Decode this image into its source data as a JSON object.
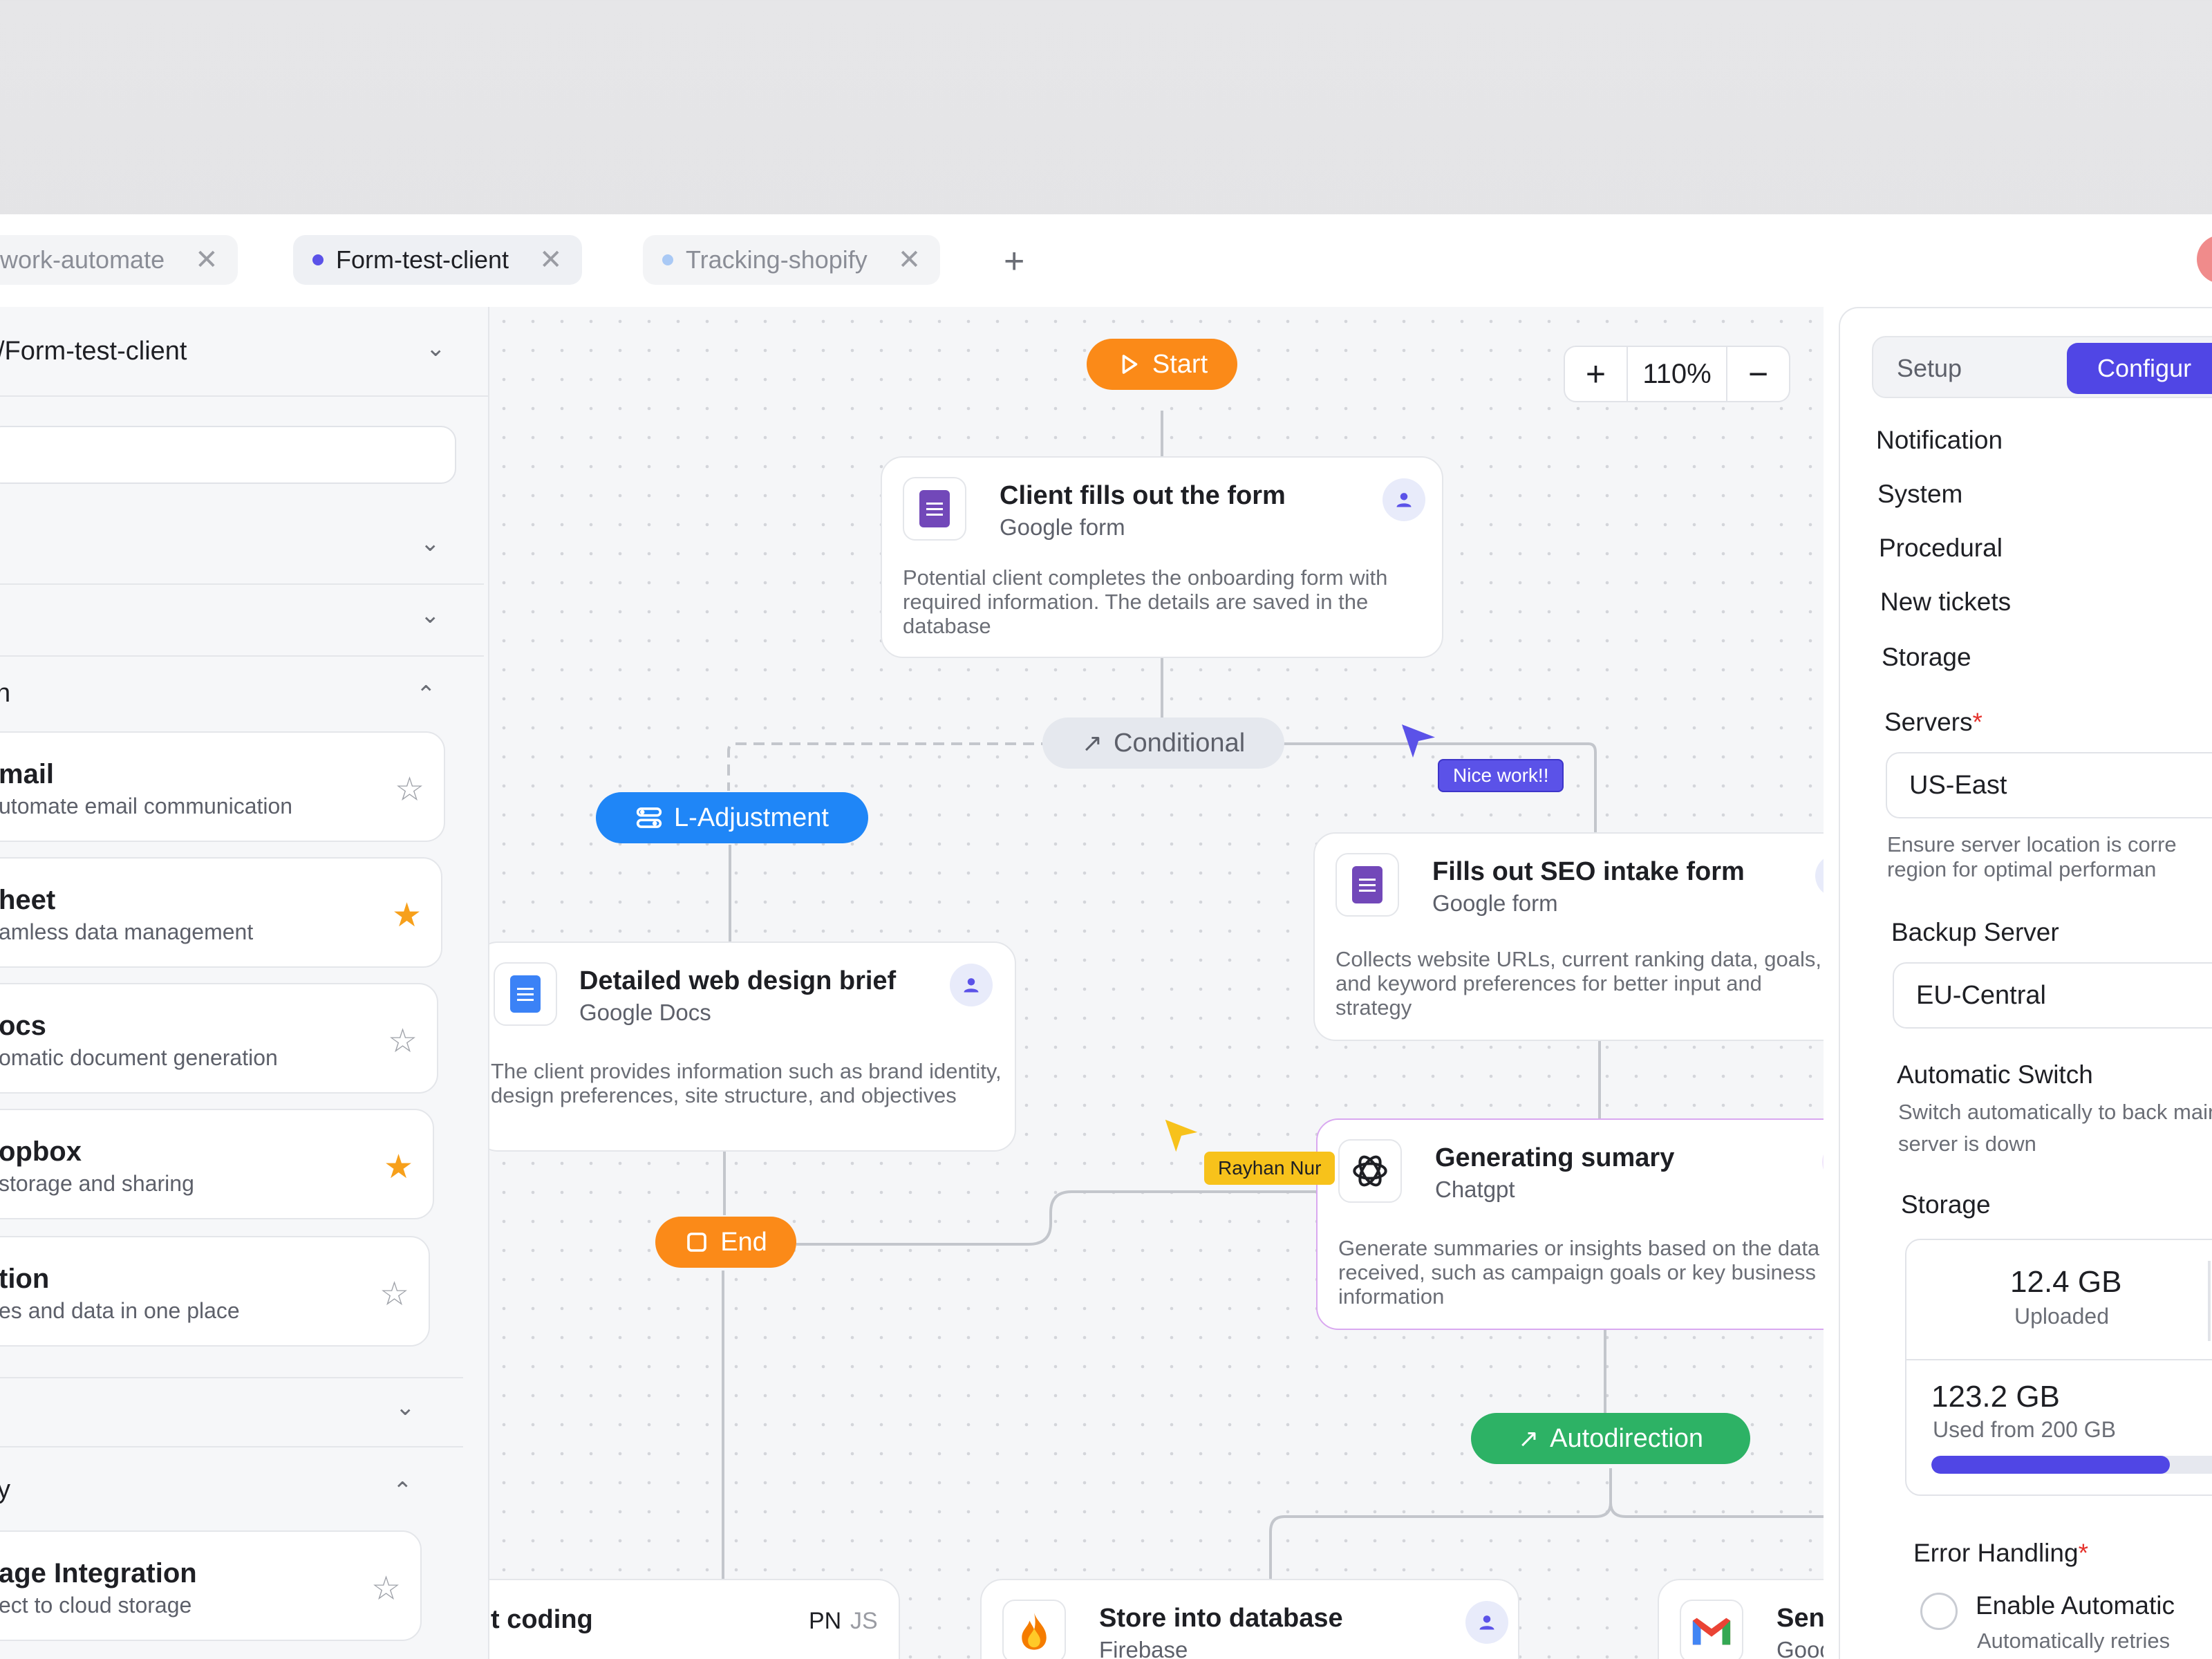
{
  "tabs": [
    {
      "label": "work-automate",
      "active": false,
      "dot_color": ""
    },
    {
      "label": "Form-test-client",
      "active": true,
      "dot_color": "#5b52e8"
    },
    {
      "label": "Tracking-shopify",
      "active": false,
      "dot_color": "#a9c9f5"
    }
  ],
  "sidebar": {
    "header": "/Form-test-client",
    "search_value": "",
    "sections": [
      {
        "label": ""
      },
      {
        "label": ""
      },
      {
        "label": "n"
      }
    ],
    "integrations": [
      {
        "title": "mail",
        "subtitle": "utomate email communication",
        "starred": false
      },
      {
        "title": "heet",
        "subtitle": "amless data management",
        "starred": true
      },
      {
        "title": "ocs",
        "subtitle": "omatic document generation",
        "starred": false
      },
      {
        "title": "opbox",
        "subtitle": "storage and sharing",
        "starred": true
      },
      {
        "title": "tion",
        "subtitle": "es and data in one place",
        "starred": false
      }
    ],
    "section_after": {
      "label": ""
    },
    "section_last": {
      "label": "y"
    },
    "bottom_card": {
      "title": "age Integration",
      "subtitle": "ect to cloud storage",
      "starred": false
    }
  },
  "canvas": {
    "zoom": {
      "in_label": "+",
      "value": "110%",
      "out_label": "−"
    },
    "start_label": "Start",
    "end_label": "End",
    "conditional_label": "Conditional",
    "l_adjustment_label": "L-Adjustment",
    "autodirection_label": "Autodirection",
    "nodes": {
      "client_form": {
        "title": "Client fills out the form",
        "app": "Google form",
        "description": "Potential client completes the onboarding form with required information. The details are saved in the database"
      },
      "web_brief": {
        "title": "Detailed web design brief",
        "app": "Google Docs",
        "description": "The client provides information such as brand identity, design preferences, site structure, and objectives"
      },
      "seo_form": {
        "title": "Fills out SEO intake form",
        "app": "Google form",
        "description": "Collects website URLs, current ranking data, goals, and keyword preferences for better input and strategy"
      },
      "summary": {
        "title": "Generating sumary",
        "app": "Chatgpt",
        "description": "Generate summaries or insights based on the data received, such as campaign goals or key business information"
      },
      "store_db": {
        "title": "Store into database",
        "app": "Firebase"
      },
      "send": {
        "title": "Send a",
        "app": "Google"
      },
      "coding": {
        "title": "t coding",
        "tag1": "PN",
        "tag2": "JS"
      }
    },
    "cursors": [
      {
        "name": "Nice work!!",
        "color": "#5b52e8"
      },
      {
        "name": "Rayhan Nur",
        "color": "#f7c21b"
      }
    ]
  },
  "panel": {
    "tabs": {
      "setup": "Setup",
      "configure": "Configur"
    },
    "notification_title": "Notification",
    "notification_items": [
      "System",
      "Procedural",
      "New tickets",
      "Storage"
    ],
    "servers_label": "Servers",
    "servers_value": "US-East",
    "servers_hint": "Ensure server location is corre region for optimal performan",
    "backup_label": "Backup Server",
    "backup_value": "EU-Central",
    "auto_switch_label": "Automatic Switch",
    "auto_switch_hint": "Switch automatically to back main server is down",
    "storage_label": "Storage",
    "storage": {
      "uploaded_value": "12.4 GB",
      "uploaded_label": "Uploaded",
      "used_value": "123.2 GB",
      "used_label": "Used from 200 GB",
      "used_fraction": 0.616
    },
    "error_label": "Error Handling",
    "enable_auto_label": "Enable Automatic",
    "enable_auto_hint": "Automatically retries"
  },
  "colors": {
    "accent": "#5046e5",
    "orange": "#fb8a18",
    "blue": "#1f86f7",
    "green": "#2db265",
    "star": "#f7a01b"
  },
  "icons": [
    "play-icon",
    "document-icon",
    "user-icon",
    "arrow-up-right-icon",
    "adjustments-icon",
    "square-icon",
    "plus-icon",
    "chatgpt-icon",
    "firebase-icon",
    "gmail-icon",
    "star-icon",
    "chevron-down-icon",
    "chevron-up-icon",
    "close-icon",
    "sparkle-icon"
  ]
}
